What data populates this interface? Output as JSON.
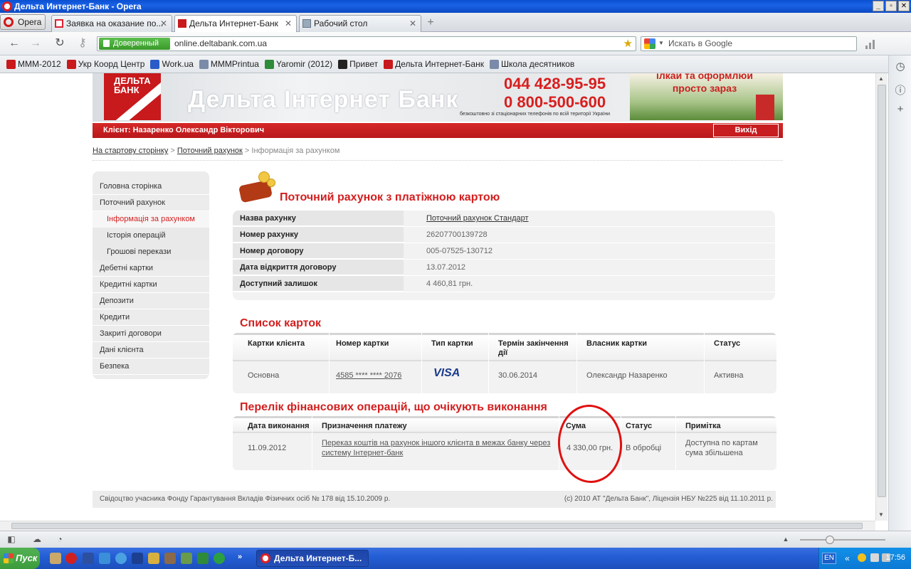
{
  "window": {
    "title": "Дельта Интернет-Банк - Opera"
  },
  "browser": {
    "menu_label": "Opera",
    "tabs": [
      {
        "label": "Заявка на оказание по...",
        "icon": "gmail-icon",
        "active": false
      },
      {
        "label": "Дельта Интернет-Банк",
        "icon": "deltabank-icon",
        "active": true
      },
      {
        "label": "Рабочий стол",
        "icon": "speed-dial-icon",
        "active": false
      }
    ],
    "trusted_label": "Доверенный",
    "url": "online.deltabank.com.ua",
    "search_placeholder": "Искать в Google",
    "bookmarks": [
      {
        "label": "МММ-2012",
        "color": "#c8191c"
      },
      {
        "label": "Укр Коорд Центр",
        "color": "#c8191c"
      },
      {
        "label": "Work.ua",
        "color": "#2a5cc8"
      },
      {
        "label": "МММPrintua",
        "color": "#7a8aa8"
      },
      {
        "label": "Yaromir (2012)",
        "color": "#2e8b3a"
      },
      {
        "label": "Привет",
        "color": "#222222"
      },
      {
        "label": "Дельта Интернет-Банк",
        "color": "#c8191c"
      },
      {
        "label": "Школа десятников",
        "color": "#7a8aa8"
      }
    ]
  },
  "bank": {
    "logo_text": "ДЕЛЬТА БАНК",
    "banner_title": "Дельта Інтернет Банк",
    "phone1": "044 428-95-95",
    "phone2": "0 800-500-600",
    "phone_note": "безкоштовно зі стаціонарних телефонів по всій території України",
    "promo_line1": "ілкай та оформлюй",
    "promo_line2": "просто зараз",
    "client_label": "Клієнт: Назаренко Олександр Вікторович",
    "exit_label": "Вихід",
    "breadcrumb": {
      "home": "На стартову сторінку",
      "sep1": " > ",
      "account": "Поточний рахунок",
      "sep2": " > ",
      "current": "Інформація за рахунком"
    },
    "menu": [
      {
        "label": "Головна сторінка",
        "sub": false,
        "active": false
      },
      {
        "label": "Поточний рахунок",
        "sub": false,
        "active": false
      },
      {
        "label": "Інформація за рахунком",
        "sub": true,
        "active": true
      },
      {
        "label": "Історія операцій",
        "sub": true,
        "active": false
      },
      {
        "label": "Грошові перекази",
        "sub": true,
        "active": false
      },
      {
        "label": "Дебетні картки",
        "sub": false,
        "active": false
      },
      {
        "label": "Кредитні картки",
        "sub": false,
        "active": false
      },
      {
        "label": "Депозити",
        "sub": false,
        "active": false
      },
      {
        "label": "Кредити",
        "sub": false,
        "active": false
      },
      {
        "label": "Закриті договори",
        "sub": false,
        "active": false
      },
      {
        "label": "Дані клієнта",
        "sub": false,
        "active": false
      },
      {
        "label": "Безпека",
        "sub": false,
        "active": false
      }
    ],
    "account_title": "Поточний рахунок з платіжною картою",
    "account_info": [
      {
        "key": "Назва рахунку",
        "value": "Поточний рахунок Стандарт",
        "link": true
      },
      {
        "key": "Номер рахунку",
        "value": "26207700139728",
        "link": false
      },
      {
        "key": "Номер договору",
        "value": "005-07525-130712",
        "link": false
      },
      {
        "key": "Дата відкриття договору",
        "value": "13.07.2012",
        "link": false
      },
      {
        "key": "Доступний залишок",
        "value": "4 460,81 грн.",
        "link": false
      }
    ],
    "cards_title": "Список карток",
    "cards_headers": [
      "Картки клієнта",
      "Номер картки",
      "Тип картки",
      "Термін закінчення дії",
      "Власник картки",
      "Статус"
    ],
    "cards_rows": [
      {
        "kind": "Основна",
        "number": "4585 **** **** 2076",
        "type": "VISA",
        "expiry": "30.06.2014",
        "owner": "Олександр Назаренко",
        "status": "Активна"
      }
    ],
    "ops_title": "Перелік фінансових операцій, що очікують виконання",
    "ops_headers": [
      "Дата виконання",
      "Призначення платежу",
      "Сума",
      "Статус",
      "Примітка"
    ],
    "ops_rows": [
      {
        "date": "11.09.2012",
        "purpose": "Переказ коштів на рахунок іншого клієнта в межах банку через систему Інтернет-банк",
        "amount": "4 330,00 грн.",
        "status": "В обробці",
        "note": "Доступна по картам сума збільшена"
      }
    ],
    "footer_left": "Свідоцтво учасника Фонду Гарантування Вкладів Фізичних осіб № 178 від 15.10.2009 р.",
    "footer_right": "(c) 2010 АТ \"Дельта Банк\", Ліцензія НБУ №225 від 11.10.2011 р."
  },
  "taskbar": {
    "start_label": "Пуск",
    "task_label": "Дельта Интернет-Б...",
    "lang": "EN",
    "clock": "17:56"
  }
}
